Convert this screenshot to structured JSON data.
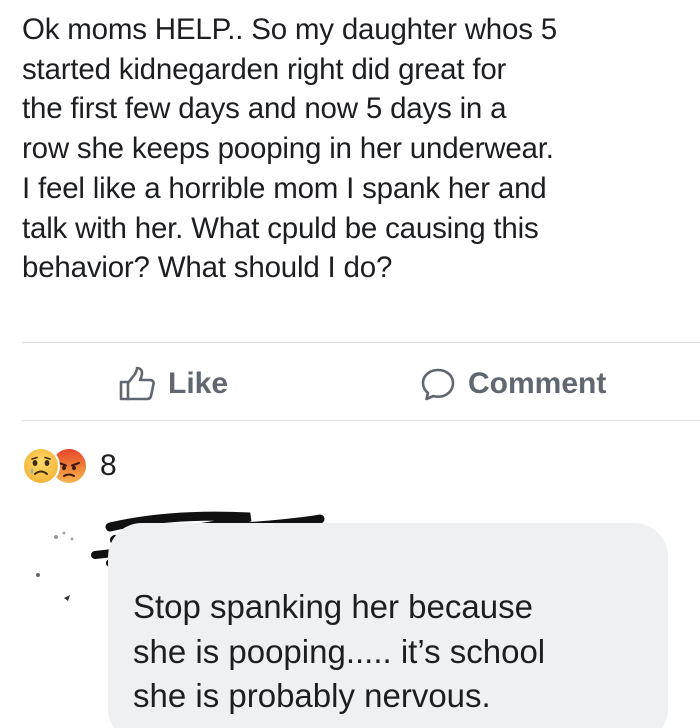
{
  "post": {
    "text": "Ok moms HELP.. So my daughter whos 5\nstarted kidnegarden right did great for\nthe first few days and now 5 days in a\nrow she keeps pooping in her underwear.\nI feel like a horrible mom I spank her and\ntalk with her. What cpuld be causing this\nbehavior? What should I do?"
  },
  "actions": {
    "like_label": "Like",
    "comment_label": "Comment",
    "like_icon": "thumbs-up-icon",
    "comment_icon": "speech-bubble-icon"
  },
  "reactions": {
    "types": [
      "sad",
      "angry"
    ],
    "count": "8"
  },
  "comment": {
    "text": "Stop spanking her because\nshe is pooping..... it’s school\nshe is probably nervous."
  },
  "colors": {
    "text": "#1c1e21",
    "muted": "#606770",
    "bubble": "#eef0f2",
    "divider": "#dcdfe4"
  }
}
